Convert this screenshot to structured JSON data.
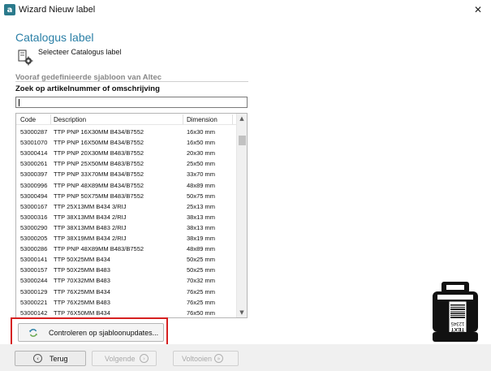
{
  "window": {
    "app_icon_glyph": "a",
    "title": "Wizard Nieuw label",
    "close_glyph": "✕"
  },
  "header": {
    "title": "Catalogus label",
    "subtitle": "Selecteer Catalogus label",
    "icon": "label-settings-icon"
  },
  "section": {
    "heading": "Vooraf gedefinieerde sjabloon van Altec",
    "search_label": "Zoek op artikelnummer of omschrijving",
    "search_value": ""
  },
  "table": {
    "columns": [
      "Code",
      "Description",
      "Dimension"
    ],
    "rows": [
      [
        "53000287",
        "TTP PNP 16X30MM B434/B7552",
        "16x30 mm"
      ],
      [
        "53001070",
        "TTP PNP 16X50MM B434/B7552",
        "16x50 mm"
      ],
      [
        "53000414",
        "TTP PNP 20X30MM B483/B7552",
        "20x30 mm"
      ],
      [
        "53000261",
        "TTP PNP 25X50MM B483/B7552",
        "25x50 mm"
      ],
      [
        "53000397",
        "TTP PNP 33X70MM B434/B7552",
        "33x70 mm"
      ],
      [
        "53000996",
        "TTP PNP 48X89MM B434/B7552",
        "48x89 mm"
      ],
      [
        "53000494",
        "TTP PNP 50X75MM B483/B7552",
        "50x75 mm"
      ],
      [
        "53000167",
        "TTP 25X13MM B434 3/RIJ",
        "25x13 mm"
      ],
      [
        "53000316",
        "TTP 38X13MM B434 2/RIJ",
        "38x13 mm"
      ],
      [
        "53000290",
        "TTP 38X13MM B483 2/RIJ",
        "38x13 mm"
      ],
      [
        "53000205",
        "TTP 38X19MM B434 2/RIJ",
        "38x19 mm"
      ],
      [
        "53000286",
        "TTP PNP 48X89MM B483/B7552",
        "48x89 mm"
      ],
      [
        "53000141",
        "TTP 50X25MM B434",
        "50x25 mm"
      ],
      [
        "53000157",
        "TTP 50X25MM B483",
        "50x25 mm"
      ],
      [
        "53000244",
        "TTP 70X32MM B483",
        "70x32 mm"
      ],
      [
        "53000129",
        "TTP 76X25MM B434",
        "76x25 mm"
      ],
      [
        "53000221",
        "TTP 76X25MM B483",
        "76x25 mm"
      ],
      [
        "53000142",
        "TTP 76X50MM B434",
        "76x50 mm"
      ]
    ],
    "scroll_up_glyph": "▲",
    "scroll_down_glyph": "▼"
  },
  "update_button": {
    "label": "Controleren op sjabloonupdates...",
    "icon": "refresh-icon"
  },
  "footer": {
    "back_label": "Terug",
    "back_glyph": "‹",
    "next_label": "Volgende",
    "next_glyph": "›",
    "finish_label": "Voltooien",
    "finish_glyph": "»"
  },
  "illustration": {
    "icon": "label-printer-icon",
    "label_text": "TEXT",
    "label_number": "12345"
  },
  "colors": {
    "title_accent": "#2a7fa6",
    "highlight": "#d62020",
    "app_icon": "#2b7a8c"
  }
}
